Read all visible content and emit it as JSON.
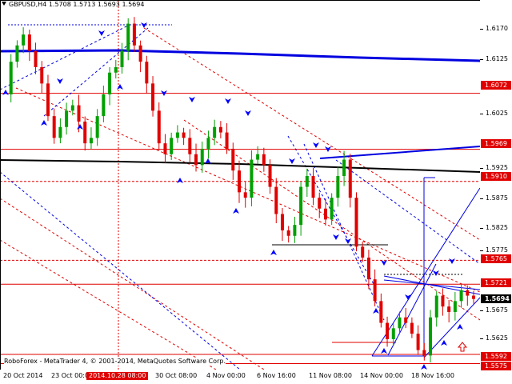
{
  "header": {
    "symbol": "GBPUSD,H4",
    "open": "1.5708",
    "high": "1.5713",
    "low": "1.5693",
    "close": "1.5694"
  },
  "copyright": "RoboForex - MetaTrader 4, © 2001-2014, MetaQuotes Software Corp.",
  "colors": {
    "bull": "#00a000",
    "bear": "#e00000",
    "level": "#e00000",
    "trend_blue": "#0000e0",
    "long_black": "#000000",
    "arrow": "#0000ff",
    "up_arrow": "#e00000"
  },
  "price_axis": {
    "ticks": [
      "1.6170",
      "1.6125",
      "1.6025",
      "1.5975",
      "1.5925",
      "1.5875",
      "1.5825",
      "1.5775",
      "1.5675",
      "1.5625",
      "1.5575"
    ],
    "tags": [
      "1.6072",
      "1.5969",
      "1.5910",
      "1.5765",
      "1.5721",
      "1.5592",
      "1.5575"
    ],
    "current": "1.5694"
  },
  "time_axis": {
    "labels": [
      "20 Oct 2014",
      "23 Oct 00:00",
      "2014.10.28 08:00",
      "30 Oct 08:00",
      "4 Nov 00:00",
      "6 Nov 16:00",
      "11 Nov 08:00",
      "14 Nov 00:00",
      "18 Nov 16:00"
    ],
    "highlighted": "2014.10.28 08:00"
  },
  "chart_data": {
    "type": "candlestick",
    "title": "GBPUSD,H4",
    "symbol": "GBPUSD",
    "timeframe": "H4",
    "last_bar": {
      "open": 1.5708,
      "high": 1.5713,
      "low": 1.5693,
      "close": 1.5694
    },
    "ylim": [
      1.556,
      1.62
    ],
    "horizontal_levels": [
      1.6072,
      1.5969,
      1.591,
      1.5765,
      1.5721,
      1.5592,
      1.5575
    ],
    "price_path": [
      1.607,
      1.613,
      1.616,
      1.618,
      1.615,
      1.612,
      1.609,
      1.603,
      1.599,
      1.601,
      1.604,
      1.605,
      1.602,
      1.598,
      1.599,
      1.603,
      1.607,
      1.611,
      1.612,
      1.615,
      1.62,
      1.616,
      1.613,
      1.609,
      1.604,
      1.598,
      1.596,
      1.599,
      1.6,
      1.599,
      1.596,
      1.594,
      1.597,
      1.599,
      1.601,
      1.6,
      1.597,
      1.593,
      1.589,
      1.588,
      1.595,
      1.596,
      1.594,
      1.59,
      1.585,
      1.582,
      1.581,
      1.583,
      1.59,
      1.592,
      1.588,
      1.586,
      1.584,
      1.588,
      1.592,
      1.595,
      1.588,
      1.579,
      1.577,
      1.573,
      1.569,
      1.565,
      1.562,
      1.564,
      1.566,
      1.565,
      1.563,
      1.56,
      1.559,
      1.566,
      1.57,
      1.568,
      1.567,
      1.569,
      1.571,
      1.57,
      1.5694
    ]
  }
}
